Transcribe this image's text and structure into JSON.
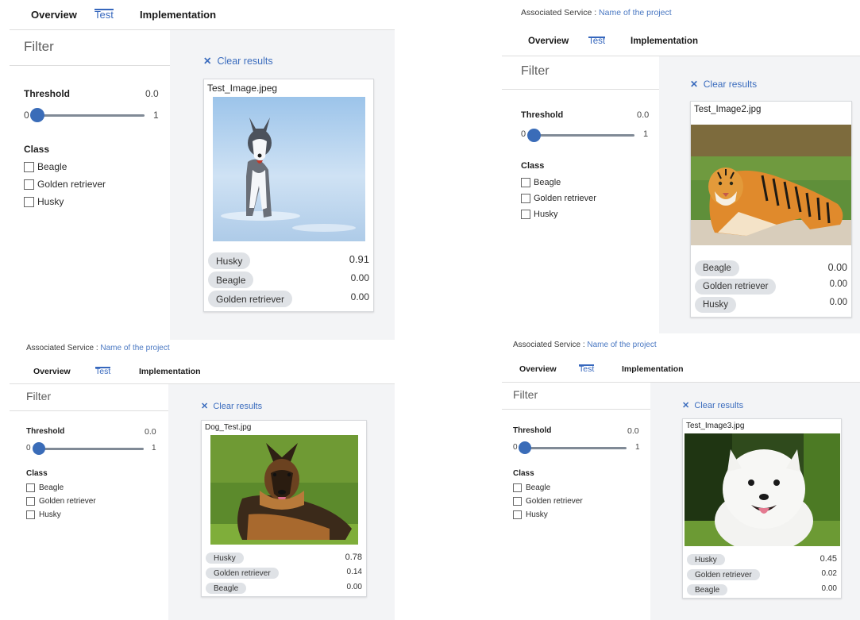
{
  "panels": [
    {
      "associated_service": {
        "label": "",
        "project": ""
      },
      "tabs": [
        "Overview",
        "Test",
        "Implementation"
      ],
      "active_tab": 1,
      "filter": {
        "title": "Filter",
        "threshold_label": "Threshold",
        "threshold_value": "0.0",
        "slider_min": "0",
        "slider_max": "1",
        "slider_level": 0.0,
        "class_label": "Class",
        "classes": [
          "Beagle",
          "Golden retriever",
          "Husky"
        ]
      },
      "clear_results": "Clear results",
      "result": {
        "file_name": "Test_Image.jpeg",
        "image_subject": "husky-on-snow",
        "predictions": [
          {
            "label": "Husky",
            "score": "0.91"
          },
          {
            "label": "Beagle",
            "score": "0.00"
          },
          {
            "label": "Golden retriever",
            "score": "0.00"
          }
        ]
      }
    },
    {
      "associated_service": {
        "label": "Associated Service : ",
        "project": "Name of the project"
      },
      "tabs": [
        "Overview",
        "Test",
        "Implementation"
      ],
      "active_tab": 1,
      "filter": {
        "title": "Filter",
        "threshold_label": "Threshold",
        "threshold_value": "0.0",
        "slider_min": "0",
        "slider_max": "1",
        "slider_level": 0.0,
        "class_label": "Class",
        "classes": [
          "Beagle",
          "Golden retriever",
          "Husky"
        ]
      },
      "clear_results": "Clear results",
      "result": {
        "file_name": "Test_Image2.jpg",
        "image_subject": "tiger-on-grass",
        "predictions": [
          {
            "label": "Beagle",
            "score": "0.00"
          },
          {
            "label": "Golden retriever",
            "score": "0.00"
          },
          {
            "label": "Husky",
            "score": "0.00"
          }
        ]
      }
    },
    {
      "associated_service": {
        "label": "Associated Service : ",
        "project": "Name of the project"
      },
      "tabs": [
        "Overview",
        "Test",
        "Implementation"
      ],
      "active_tab": 1,
      "filter": {
        "title": "Filter",
        "threshold_label": "Threshold",
        "threshold_value": "0.0",
        "slider_min": "0",
        "slider_max": "1",
        "slider_level": 0.0,
        "class_label": "Class",
        "classes": [
          "Beagle",
          "Golden retriever",
          "Husky"
        ]
      },
      "clear_results": "Clear results",
      "result": {
        "file_name": "Dog_Test.jpg",
        "image_subject": "german-shepherd-on-grass",
        "predictions": [
          {
            "label": "Husky",
            "score": "0.78"
          },
          {
            "label": "Golden retriever",
            "score": "0.14"
          },
          {
            "label": "Beagle",
            "score": "0.00"
          }
        ]
      }
    },
    {
      "associated_service": {
        "label": "Associated Service : ",
        "project": "Name of the project"
      },
      "tabs": [
        "Overview",
        "Test",
        "Implementation"
      ],
      "active_tab": 1,
      "filter": {
        "title": "Filter",
        "threshold_label": "Threshold",
        "threshold_value": "0.0",
        "slider_min": "0",
        "slider_max": "1",
        "slider_level": 0.0,
        "class_label": "Class",
        "classes": [
          "Beagle",
          "Golden retriever",
          "Husky"
        ]
      },
      "clear_results": "Clear results",
      "result": {
        "file_name": "Test_Image3.jpg",
        "image_subject": "white-pomeranian",
        "predictions": [
          {
            "label": "Husky",
            "score": "0.45"
          },
          {
            "label": "Golden retriever",
            "score": "0.02"
          },
          {
            "label": "Beagle",
            "score": "0.00"
          }
        ]
      }
    }
  ],
  "colors": {
    "accent": "#3667bd",
    "link": "#4a78c2",
    "slider_knob": "#3a6cb8",
    "results_background": "#f3f4f6",
    "pill": "#dfe2e6"
  }
}
